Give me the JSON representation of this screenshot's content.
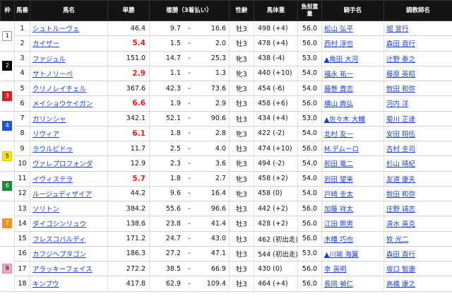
{
  "headers": {
    "waku": "枠",
    "num": "馬番",
    "name": "馬名",
    "win": "単勝",
    "place": "複勝（3着払い）",
    "sex": "性齢",
    "weight": "馬体重",
    "jw": "負担重量",
    "jockey": "騎手名",
    "trainer": "調教師名"
  },
  "waku_colors": [
    "#ffffff",
    "#000000",
    "#d32020",
    "#1e57c9",
    "#f5e21c",
    "#1f8a3a",
    "#f29218",
    "#f4a5c0"
  ],
  "wakus": [
    {
      "label": "1",
      "rows": 2
    },
    {
      "label": "2",
      "rows": 2
    },
    {
      "label": "3",
      "rows": 2
    },
    {
      "label": "4",
      "rows": 2
    },
    {
      "label": "5",
      "rows": 2
    },
    {
      "label": "6",
      "rows": 2
    },
    {
      "label": "7",
      "rows": 3
    },
    {
      "label": "8",
      "rows": 3
    }
  ],
  "horses": [
    {
      "num": "1",
      "name": "シュトルーヴェ",
      "odds": "46.4",
      "pop": false,
      "place_lo": "9.7",
      "place_dash": "-",
      "place_hi": "16.6",
      "sex": "牡3",
      "weight": "498 (+4)",
      "jw": "56.0",
      "jockey": "松山 弘平",
      "trainer": "堀 宣行"
    },
    {
      "num": "2",
      "name": "カイザー",
      "odds": "5.4",
      "pop": true,
      "place_lo": "1.5",
      "place_dash": "-",
      "place_hi": "2.0",
      "sex": "牡3",
      "weight": "478 (+4)",
      "jw": "56.0",
      "jockey": "西村 淳也",
      "trainer": "森田 直行"
    },
    {
      "num": "3",
      "name": "ファジュル",
      "odds": "151.0",
      "pop": false,
      "place_lo": "14.7",
      "place_dash": "-",
      "place_hi": "25.3",
      "sex": "牝3",
      "weight": "438 (-4)",
      "jw": "53.0",
      "jockey": "▲角田 大河",
      "trainer": "辻野 泰之"
    },
    {
      "num": "4",
      "name": "サトノリーベ",
      "odds": "2.9",
      "pop": true,
      "place_lo": "1.1",
      "place_dash": "-",
      "place_hi": "1.3",
      "sex": "牝3",
      "weight": "440 (+10)",
      "jw": "54.0",
      "jockey": "福永 祐一",
      "trainer": "藤原 英昭"
    },
    {
      "num": "5",
      "name": "クリノレイチェル",
      "odds": "367.6",
      "pop": false,
      "place_lo": "42.3",
      "place_dash": "-",
      "place_hi": "73.6",
      "sex": "牝3",
      "weight": "454 (-6)",
      "jw": "54.0",
      "jockey": "藤懸 貴志",
      "trainer": "牧田 和弥"
    },
    {
      "num": "6",
      "name": "メイショウケイガン",
      "odds": "6.6",
      "pop": true,
      "place_lo": "1.9",
      "place_dash": "-",
      "place_hi": "2.9",
      "sex": "牡3",
      "weight": "458 (+6)",
      "jw": "56.0",
      "jockey": "横山 典弘",
      "trainer": "河内 洋"
    },
    {
      "num": "7",
      "name": "ガリンシャ",
      "odds": "342.1",
      "pop": false,
      "place_lo": "52.1",
      "place_dash": "-",
      "place_hi": "90.6",
      "sex": "牡3",
      "weight": "434 (+4)",
      "jw": "53.0",
      "jockey": "▲佐々木 大輔",
      "trainer": "菊川 正達"
    },
    {
      "num": "8",
      "name": "リヴィア",
      "odds": "6.1",
      "pop": true,
      "place_lo": "1.8",
      "place_dash": "-",
      "place_hi": "2.8",
      "sex": "牝3",
      "weight": "422 (-2)",
      "jw": "54.0",
      "jockey": "北村 友一",
      "trainer": "安田 翔伍"
    },
    {
      "num": "9",
      "name": "ラウルピドゥ",
      "odds": "11.7",
      "pop": false,
      "place_lo": "2.5",
      "place_dash": "-",
      "place_hi": "4.0",
      "sex": "牡3",
      "weight": "474 (+10)",
      "jw": "56.0",
      "jockey": "M.デムーロ",
      "trainer": "吉村 圭司"
    },
    {
      "num": "10",
      "name": "ヴァレプロフォンダ",
      "odds": "12.9",
      "pop": false,
      "place_lo": "2.3",
      "place_dash": "-",
      "place_hi": "3.6",
      "sex": "牝3",
      "weight": "494 (-2)",
      "jw": "54.0",
      "jockey": "和田 竜二",
      "trainer": "杉山 晴紀"
    },
    {
      "num": "11",
      "name": "イヴィステラ",
      "odds": "5.7",
      "pop": true,
      "place_lo": "1.8",
      "place_dash": "-",
      "place_hi": "2.7",
      "sex": "牝3",
      "weight": "458 (+2)",
      "jw": "54.0",
      "jockey": "岩田 望来",
      "trainer": "友道 康夫"
    },
    {
      "num": "12",
      "name": "ルージュディザイア",
      "odds": "44.2",
      "pop": false,
      "place_lo": "9.6",
      "place_dash": "-",
      "place_hi": "16.4",
      "sex": "牝3",
      "weight": "458 (0)",
      "jw": "54.0",
      "jockey": "戸崎 圭太",
      "trainer": "牧田 和弥"
    },
    {
      "num": "13",
      "name": "ソリトン",
      "odds": "384.2",
      "pop": false,
      "place_lo": "55.6",
      "place_dash": "-",
      "place_hi": "96.6",
      "sex": "牡3",
      "weight": "442 (+2)",
      "jw": "56.0",
      "jockey": "加藤 祥太",
      "trainer": "庄野 靖志"
    },
    {
      "num": "14",
      "name": "ダイゴシンリュウ",
      "odds": "138.6",
      "place_lo": "23.8",
      "place_dash": "-",
      "place_hi": "41.4",
      "pop": false,
      "sex": "牡3",
      "weight": "428 (+2)",
      "jw": "56.0",
      "jockey": "江田 照男",
      "trainer": "清水 英克"
    },
    {
      "num": "15",
      "name": "フレスコバルディ",
      "odds": "171.2",
      "pop": false,
      "place_lo": "24.7",
      "place_dash": "-",
      "place_hi": "43.0",
      "sex": "牡3",
      "weight": "462 (初出走)",
      "jw": "56.0",
      "jockey": "木幡 巧也",
      "trainer": "牧 光二"
    },
    {
      "num": "16",
      "name": "カフジヘプタゴン",
      "odds": "186.3",
      "pop": false,
      "place_lo": "27.2",
      "place_dash": "-",
      "place_hi": "47.1",
      "sex": "牡3",
      "weight": "544 (初出走)",
      "jw": "53.0",
      "jockey": "▲川端 海翼",
      "trainer": "森田 直行"
    },
    {
      "num": "17",
      "name": "アラッキーフェイス",
      "odds": "272.2",
      "pop": false,
      "place_lo": "38.5",
      "place_dash": "-",
      "place_hi": "66.9",
      "sex": "牡3",
      "weight": "430 (0)",
      "jw": "56.0",
      "jockey": "幸 英明",
      "trainer": "坂口 智康"
    },
    {
      "num": "18",
      "name": "キンプウ",
      "odds": "417.8",
      "pop": false,
      "place_lo": "62.9",
      "place_dash": "-",
      "place_hi": "109.4",
      "sex": "牡3",
      "weight": "464 (+4)",
      "jw": "56.0",
      "jockey": "長岡 禎仁",
      "trainer": "高橋 康之"
    }
  ]
}
